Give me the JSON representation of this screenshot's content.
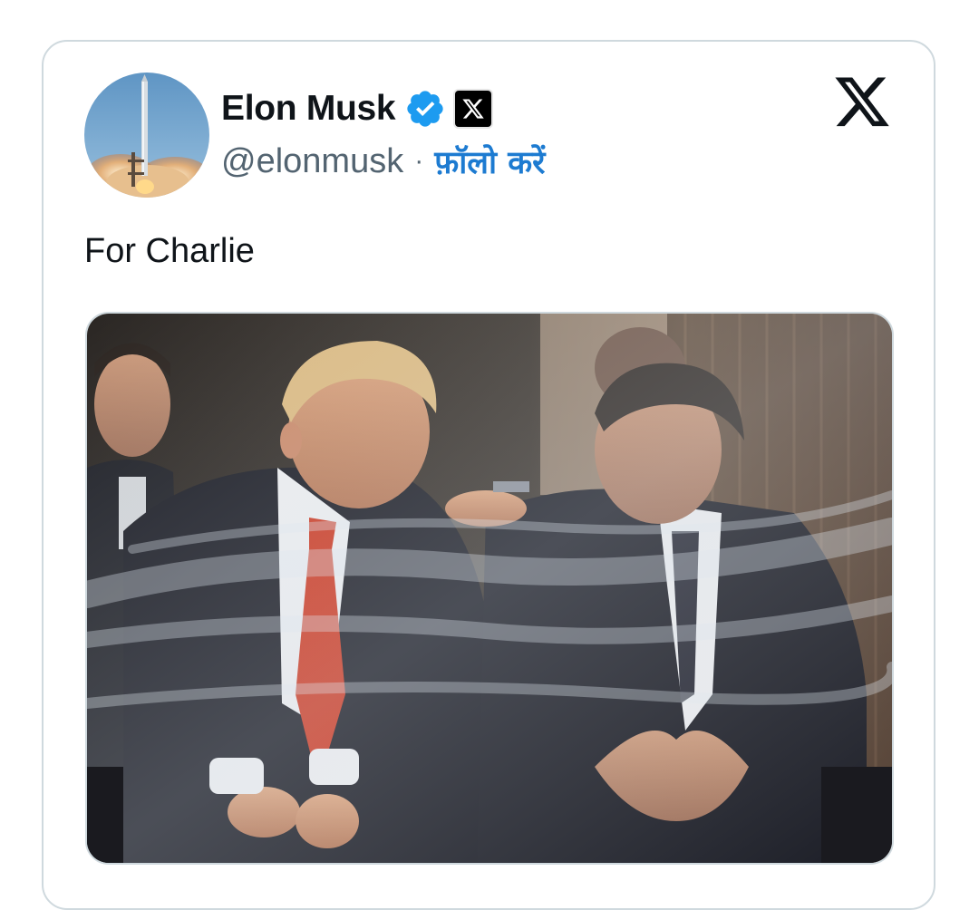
{
  "author": {
    "display_name": "Elon Musk",
    "handle": "@elonmusk",
    "separator": "·",
    "follow_label": "फ़ॉलो करें",
    "verified": true,
    "verified_icon": "verified-badge-icon",
    "affiliation_icon": "x-logo-badge-icon",
    "avatar": "rocket-launch-avatar"
  },
  "brand": {
    "icon": "x-logo-icon"
  },
  "tweet": {
    "text": "For Charlie",
    "media": "photo-two-men-seated-talking-behind-glass"
  },
  "colors": {
    "link": "#1d7bd1",
    "verified": "#1d9bf0",
    "border": "#cfd9de",
    "text": "#0f1419",
    "secondary": "#536471"
  }
}
